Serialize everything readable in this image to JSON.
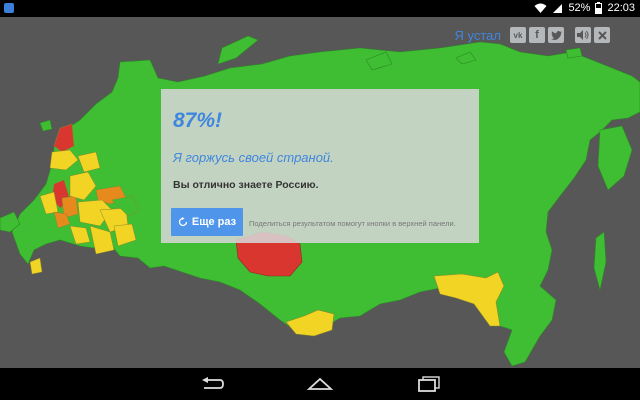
{
  "status_bar": {
    "battery_percent": "52%",
    "time": "22:03"
  },
  "toolbar": {
    "tired_label": "Я устал",
    "share_buttons": [
      "vk-icon",
      "facebook-icon",
      "twitter-icon"
    ],
    "sound_icon": "speaker-icon",
    "close_icon": "close-icon"
  },
  "result": {
    "score": "87%!",
    "verdict": "Я горжусь своей страной.",
    "message": "Вы отлично знаете Россию.",
    "again_label": "Еще раз",
    "hint": "Поделиться результатом помогут кнопки в верхней панели."
  },
  "map_colors": {
    "background": "#575757",
    "correct": "#3fbd33",
    "partial": "#f2d524",
    "mistake_orange": "#e78a1e",
    "wrong": "#d9362f",
    "border": "#2d8a25"
  },
  "nav_bar": {
    "back_icon": "back-icon",
    "home_icon": "home-icon",
    "recents_icon": "recents-icon"
  }
}
